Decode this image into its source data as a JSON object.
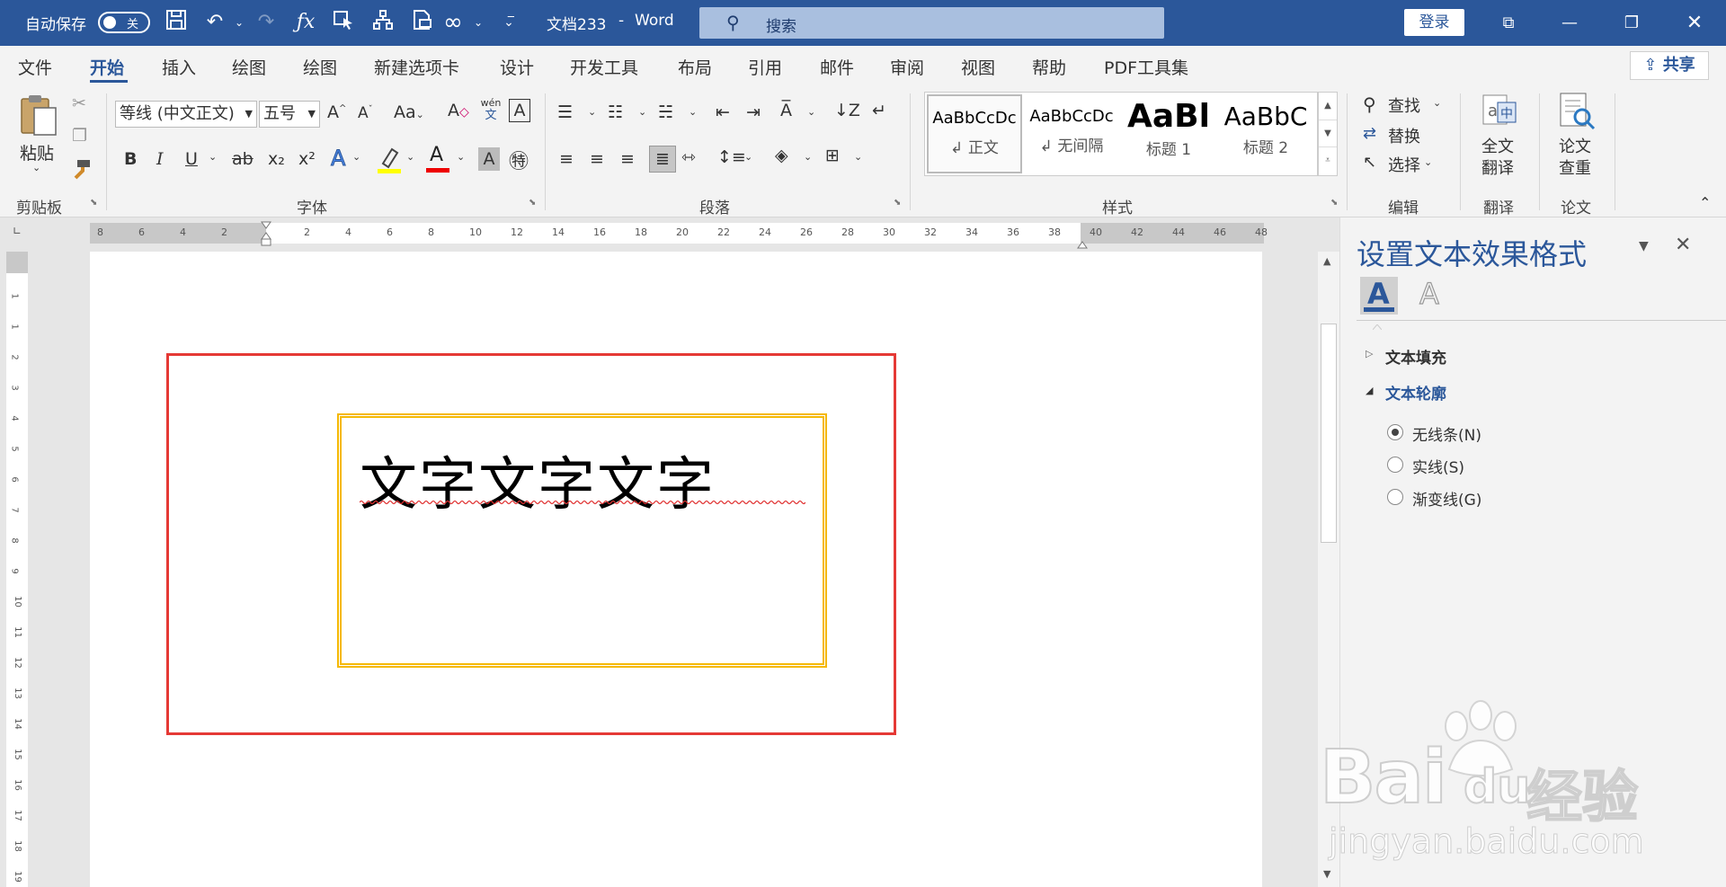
{
  "titlebar": {
    "autosave_label": "自动保存",
    "autosave_state": "关",
    "doc_title": "文档233",
    "separator": "-",
    "app_name": "Word",
    "search_placeholder": "搜索",
    "login_label": "登录"
  },
  "tabs": [
    "文件",
    "开始",
    "插入",
    "绘图",
    "绘图",
    "新建选项卡",
    "设计",
    "开发工具",
    "布局",
    "引用",
    "邮件",
    "审阅",
    "视图",
    "帮助",
    "PDF工具集"
  ],
  "share_label": "共享",
  "ribbon": {
    "clipboard": {
      "paste": "粘贴",
      "group": "剪贴板"
    },
    "font": {
      "name": "等线 (中文正文)",
      "size": "五号",
      "case_btn": "Aa",
      "bold": "B",
      "italic": "I",
      "underline": "U",
      "strike": "ab",
      "subscript": "x₂",
      "superscript": "x²",
      "phonetic_top": "wén",
      "phonetic_bottom": "文",
      "group": "字体"
    },
    "paragraph": {
      "group": "段落"
    },
    "styles": {
      "items": [
        {
          "preview": "AaBbCcDc",
          "name": "正文"
        },
        {
          "preview": "AaBbCcDc",
          "name": "无间隔"
        },
        {
          "preview": "AaBl",
          "name": "标题 1"
        },
        {
          "preview": "AaBbC",
          "name": "标题 2"
        }
      ],
      "group": "样式"
    },
    "editing": {
      "find": "查找",
      "replace": "替换",
      "select": "选择",
      "group": "编辑"
    },
    "translate": {
      "btn_line1": "全文",
      "btn_line2": "翻译",
      "group": "翻译"
    },
    "paper": {
      "btn_line1": "论文",
      "btn_line2": "查重",
      "group": "论文"
    }
  },
  "ruler": {
    "h_left": [
      "8",
      "6",
      "4",
      "2"
    ],
    "h_right": [
      "2",
      "4",
      "6",
      "8",
      "10",
      "12",
      "14",
      "16",
      "18",
      "20",
      "22",
      "24",
      "26",
      "28",
      "30",
      "32",
      "34",
      "36",
      "38",
      "40",
      "42",
      "44",
      "46",
      "48"
    ],
    "v": [
      "1",
      "1",
      "2",
      "3",
      "4",
      "5",
      "6",
      "7",
      "8",
      "9",
      "10",
      "11",
      "12",
      "13",
      "14",
      "15",
      "16",
      "17",
      "18",
      "19"
    ]
  },
  "document": {
    "text": "文字文字文字"
  },
  "pane": {
    "title": "设置文本效果格式",
    "sections": [
      {
        "label": "文本填充",
        "expanded": false
      },
      {
        "label": "文本轮廓",
        "expanded": true
      }
    ],
    "options": [
      {
        "label": "无线条(N)",
        "selected": true
      },
      {
        "label": "实线(S)",
        "selected": false
      },
      {
        "label": "渐变线(G)",
        "selected": false
      }
    ]
  },
  "watermark": {
    "brand": "Bai",
    "brand2": "du",
    "cn": "经验",
    "url": "jingyan.baidu.com"
  },
  "colors": {
    "accent": "#2b579a",
    "red_box": "#e53935",
    "yellow_box": "#f5b800"
  }
}
